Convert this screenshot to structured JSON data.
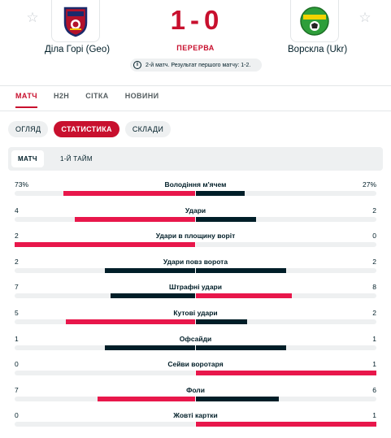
{
  "match": {
    "home_team": "Діла Горі (Geo)",
    "away_team": "Ворскла (Ukr)",
    "home_score": "1",
    "separator": "-",
    "away_score": "0",
    "status": "ПЕРЕРВА",
    "info_icon": "info-icon",
    "info_icon_glyph": "i",
    "info_text": "2-й матч. Результат першого матчу: 1-2.",
    "star_glyph": "☆"
  },
  "main_tabs": [
    "МАТЧ",
    "H2H",
    "СІТКА",
    "НОВИНИ"
  ],
  "sub_tabs": [
    "ОГЛЯД",
    "СТАТИСТИКА",
    "СКЛАДИ"
  ],
  "period_tabs": [
    "МАТЧ",
    "1-Й ТАЙМ"
  ],
  "colors": {
    "accent": "#c8102e",
    "bar_leading": "#e8174b",
    "bar_trailing": "#001e28",
    "bar_track": "#eef0f1"
  },
  "stats": [
    {
      "label": "Володіння м'ячем",
      "home": "73%",
      "away": "27%",
      "home_value": 73,
      "away_value": 27
    },
    {
      "label": "Удари",
      "home": "4",
      "away": "2",
      "home_value": 4,
      "away_value": 2
    },
    {
      "label": "Удари в площину воріт",
      "home": "2",
      "away": "0",
      "home_value": 2,
      "away_value": 0
    },
    {
      "label": "Удари повз ворота",
      "home": "2",
      "away": "2",
      "home_value": 2,
      "away_value": 2
    },
    {
      "label": "Штрафні удари",
      "home": "7",
      "away": "8",
      "home_value": 7,
      "away_value": 8
    },
    {
      "label": "Кутові удари",
      "home": "5",
      "away": "2",
      "home_value": 5,
      "away_value": 2
    },
    {
      "label": "Офсайди",
      "home": "1",
      "away": "1",
      "home_value": 1,
      "away_value": 1
    },
    {
      "label": "Сейви воротаря",
      "home": "0",
      "away": "1",
      "home_value": 0,
      "away_value": 1
    },
    {
      "label": "Фоли",
      "home": "7",
      "away": "6",
      "home_value": 7,
      "away_value": 6
    },
    {
      "label": "Жовті картки",
      "home": "0",
      "away": "1",
      "home_value": 0,
      "away_value": 1
    }
  ]
}
